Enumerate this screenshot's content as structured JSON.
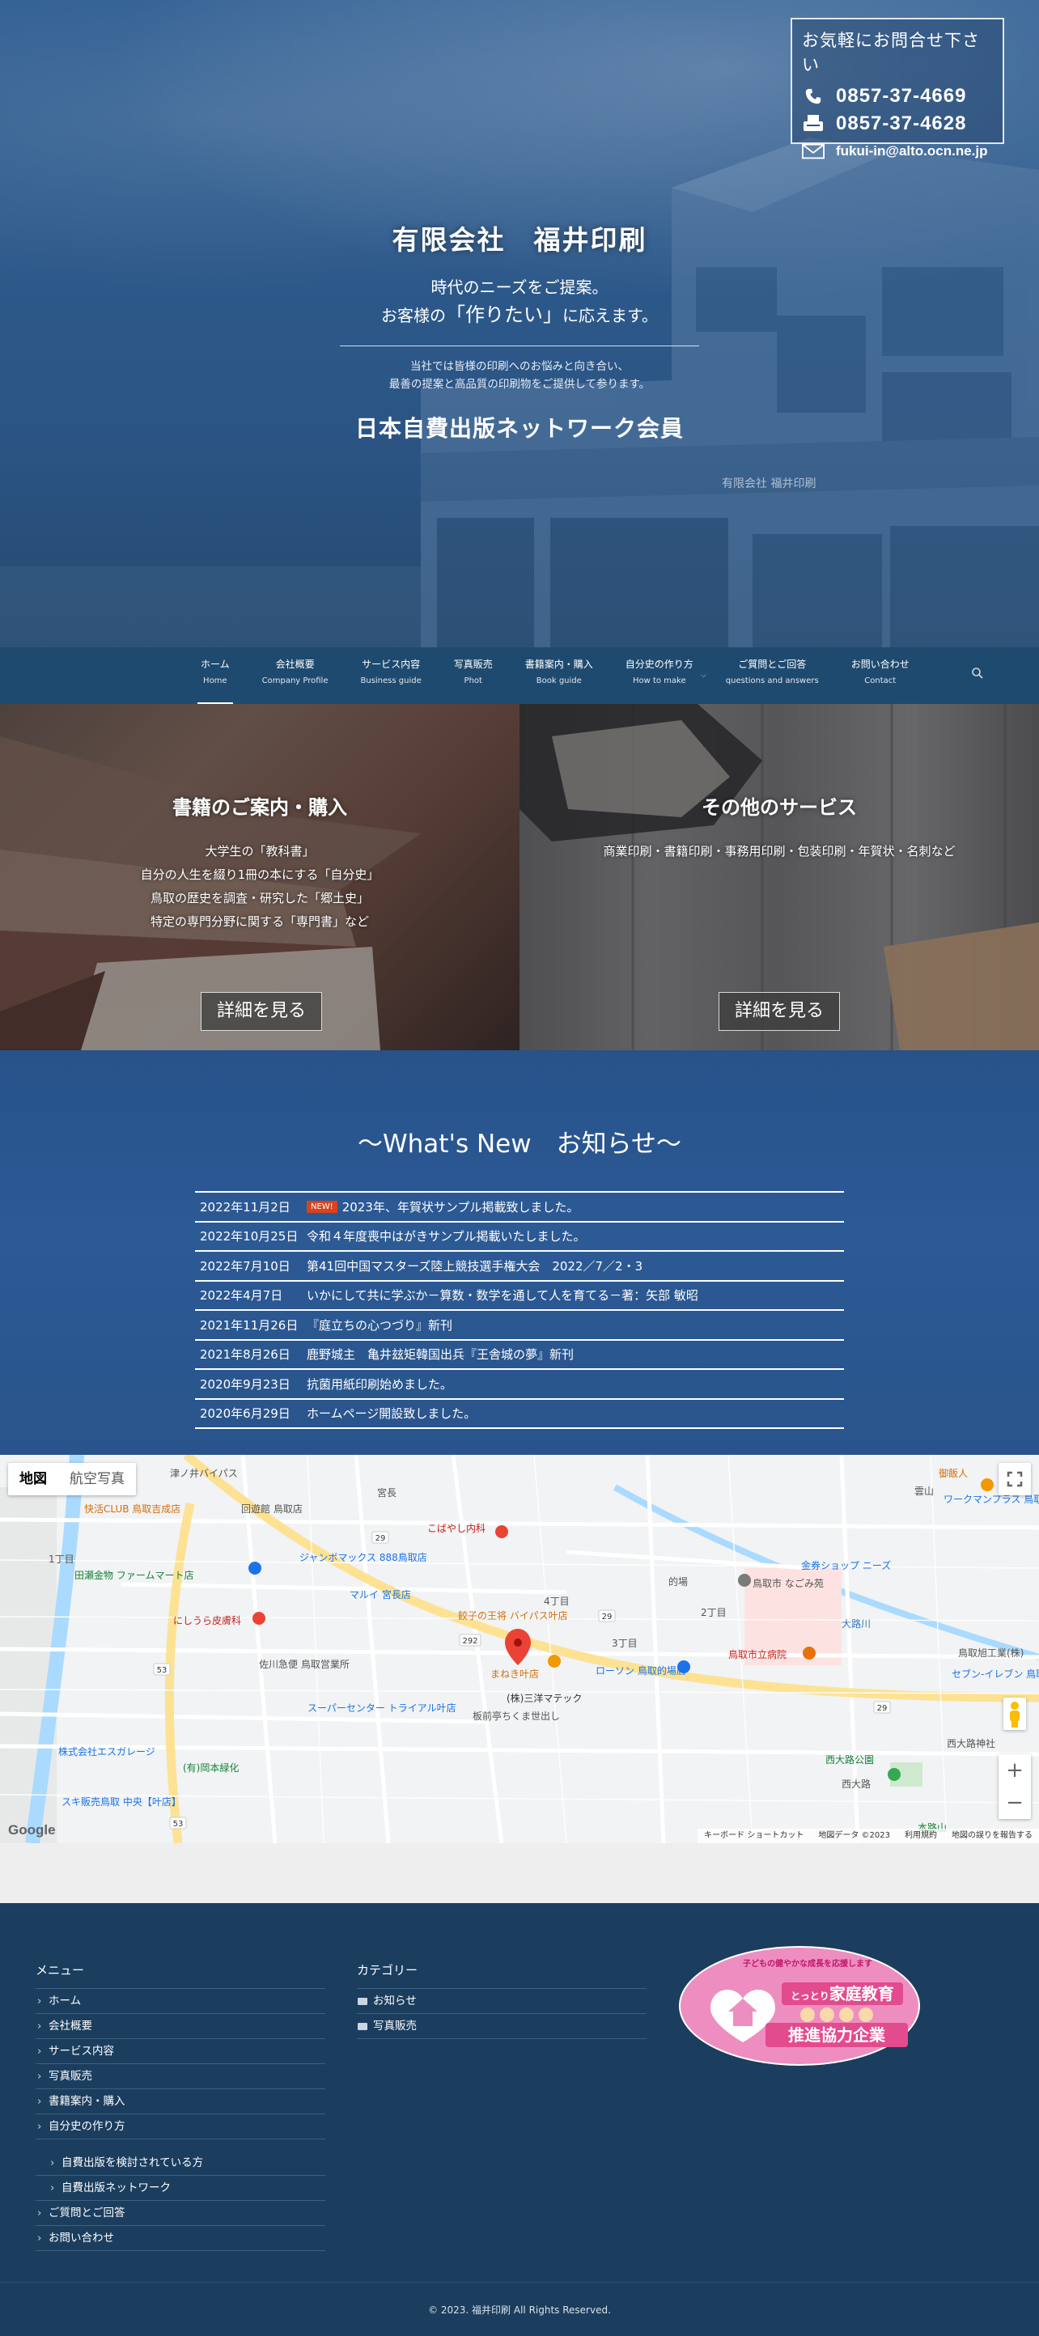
{
  "contact": {
    "title": "お気軽にお問合せ下さい",
    "phone": "0857-37-4669",
    "fax": "0857-37-4628",
    "email": "fukui-in@alto.ocn.ne.jp"
  },
  "hero": {
    "company": "有限会社　福井印刷",
    "lead_1": "時代のニーズをご提案。",
    "lead_2_pre": "お客様の",
    "lead_2_big": "「作りたい」",
    "lead_2_post": "に応えます。",
    "small_1": "当社では皆様の印刷へのお悩みと向き合い、",
    "small_2": "最善の提案と高品質の印刷物をご提供して参ります。",
    "network": "日本自費出版ネットワーク会員",
    "building_sign": "有限会社 福井印刷"
  },
  "nav": {
    "items": [
      {
        "jp": "ホーム",
        "en": "Home"
      },
      {
        "jp": "会社概要",
        "en": "Company Profile"
      },
      {
        "jp": "サービス内容",
        "en": "Business guide"
      },
      {
        "jp": "写真販売",
        "en": "Phot"
      },
      {
        "jp": "書籍案内・購入",
        "en": "Book guide"
      },
      {
        "jp": "自分史の作り方",
        "en": "How to make"
      },
      {
        "jp": "ご質問とご回答",
        "en": "questions and answers"
      },
      {
        "jp": "お問い合わせ",
        "en": "Contact"
      }
    ]
  },
  "panels": {
    "books": {
      "title": "書籍のご案内・購入",
      "lines": [
        "大学生の「教科書」",
        "自分の人生を綴り1冊の本にする「自分史」",
        "鳥取の歴史を調査・研究した「郷土史」",
        "特定の専門分野に関する「専門書」など"
      ],
      "button": "詳細を見る"
    },
    "other": {
      "title": "その他のサービス",
      "lines": [
        "商業印刷・書籍印刷・事務用印刷・包装印刷・年賀状・名刺など"
      ],
      "button": "詳細を見る"
    }
  },
  "news": {
    "title": "〜What's New　お知らせ〜",
    "new_badge": "NEW!",
    "items": [
      {
        "date": "2022年11月2日",
        "text": "2023年、年賀状サンプル掲載致しました。"
      },
      {
        "date": "2022年10月25日",
        "text": "令和４年度喪中はがきサンプル掲載いたしました。"
      },
      {
        "date": "2022年7月10日",
        "text": "第41回中国マスターズ陸上競技選手権大会　2022／7／2・3"
      },
      {
        "date": "2022年4月7日",
        "text": "いかにして共に学ぶか－算数・数学を通して人を育てる－著：矢部 敏昭"
      },
      {
        "date": "2021年11月26日",
        "text": "『庭立ちの心つづり』新刊"
      },
      {
        "date": "2021年8月26日",
        "text": "鹿野城主　亀井玆矩韓国出兵『王舎城の夢』新刊"
      },
      {
        "date": "2020年9月23日",
        "text": "抗菌用紙印刷始めました。"
      },
      {
        "date": "2020年6月29日",
        "text": "ホームページ開設致しました。"
      }
    ]
  },
  "map": {
    "tab_map": "地図",
    "tab_satellite": "航空写真",
    "labels": [
      "津ノ井バイパス",
      "快活CLUB 鳥取吉成店",
      "回遊館 鳥取店",
      "宮長",
      "こばやし内科",
      "ジャンボマックス 888鳥取店",
      "マルイ 宮長店",
      "田瀬金物 ファームマート店",
      "にしうら皮膚科",
      "佐川急便 鳥取営業所",
      "餃子の王将 バイパス叶店",
      "4丁目",
      "3丁目",
      "2丁目",
      "1丁目",
      "まねき叶店",
      "ローソン 鳥取的場店",
      "(株)三洋マテック",
      "スーパーセンター トライアル叶店",
      "板前亭ちくま世出し",
      "株式会社エスガレージ",
      "(有)岡本緑化",
      "スキ販売鳥取 中央【叶店】",
      "的場",
      "鳥取市 なごみ苑",
      "金券ショップ ニーズ",
      "鳥取市立病院",
      "大路川",
      "西大路公園",
      "西大路",
      "西大路神社",
      "御飯人",
      "雲山",
      "ワークマンプラス 鳥取雲山店",
      "鳥取旭工業(株)",
      "セブン-イレブン 鳥取雲山店",
      "本路山"
    ],
    "road_numbers": [
      "29",
      "29",
      "53",
      "53",
      "292",
      "29"
    ],
    "attribution": [
      "キーボード ショートカット",
      "地図データ ©2023",
      "利用規約",
      "地図の誤りを報告する"
    ],
    "google": "Google"
  },
  "footer": {
    "menu_title": "メニュー",
    "menu": [
      "ホーム",
      "会社概要",
      "サービス内容",
      "写真販売",
      "書籍案内・購入",
      "自分史の作り方"
    ],
    "submenu": [
      "自費出版を検討されている方",
      "自費出版ネットワーク"
    ],
    "menu_after": [
      "ご質問とご回答",
      "お問い合わせ"
    ],
    "category_title": "カテゴリー",
    "categories": [
      "お知らせ",
      "写真販売"
    ],
    "badge": {
      "top": "子どもの健やかな成長を応援します",
      "mid_1": "とっとり",
      "mid_2": "家庭教育",
      "bottom": "推進協力企業"
    },
    "copyright": "© 2023. 福井印刷 All Rights Reserved."
  },
  "colors": {
    "primary": "#1b3d5e",
    "nav": "#1f4a6f",
    "news_bg": "#2c5a95",
    "new_badge": "#d9431e",
    "map_pin": "#ea4335",
    "badge_pink": "#ee8ec0"
  }
}
